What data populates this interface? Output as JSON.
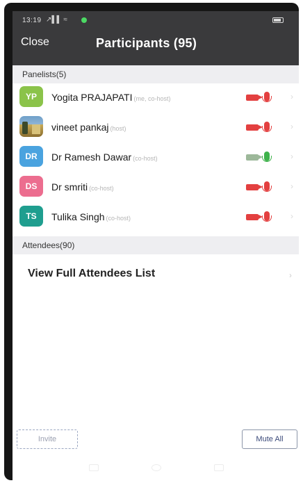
{
  "status_bar": {
    "time": "13:19",
    "icons_text": "↗▌▌ ≈"
  },
  "header": {
    "close_label": "Close",
    "title": "Participants (95)"
  },
  "panelists_section": {
    "label": "Panelists(5)"
  },
  "panelists": [
    {
      "initials": "YP",
      "avatar_color": "#8bc34a",
      "name": "Yogita PRAJAPATI",
      "role": "(me, co-host)",
      "video": "off",
      "audio": "off"
    },
    {
      "initials": "",
      "avatar_color": "photo",
      "name": "vineet pankaj",
      "role": "(host)",
      "video": "off",
      "audio": "off"
    },
    {
      "initials": "DR",
      "avatar_color": "#4aa3df",
      "name": "Dr Ramesh Dawar",
      "role": "(co-host)",
      "video": "on",
      "audio": "on"
    },
    {
      "initials": "DS",
      "avatar_color": "#ec6d8f",
      "name": "Dr smriti",
      "role": "(co-host)",
      "video": "off",
      "audio": "off"
    },
    {
      "initials": "TS",
      "avatar_color": "#1f9e8f",
      "name": "Tulika Singh",
      "role": "(co-host)",
      "video": "off",
      "audio": "off"
    }
  ],
  "attendees_section": {
    "label": "Attendees(90)",
    "view_full_label": "View Full Attendees List"
  },
  "footer": {
    "invite_label": "Invite",
    "mute_all_label": "Mute All"
  },
  "icons": {
    "chevron": "chevron-right-icon",
    "video_off_color": "#e34040",
    "mic_on_color": "#3eb24b"
  }
}
